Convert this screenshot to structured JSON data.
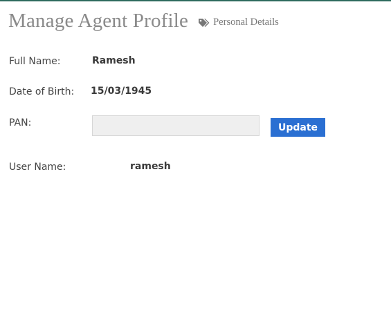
{
  "header": {
    "title": "Manage Agent Profile",
    "subtitle": "Personal Details",
    "subtitle_icon": "tags-icon"
  },
  "fields": {
    "full_name": {
      "label": "Full Name:",
      "value": "Ramesh"
    },
    "dob": {
      "label": "Date of Birth:",
      "value": "15/03/1945"
    },
    "pan": {
      "label": "PAN:",
      "value": "",
      "placeholder": ""
    },
    "username": {
      "label": "User Name:",
      "value": "ramesh"
    }
  },
  "actions": {
    "update_label": "Update"
  },
  "colors": {
    "accent": "#2a6fd2",
    "top_border": "#2e6b5e",
    "title": "#8a8a8a"
  }
}
